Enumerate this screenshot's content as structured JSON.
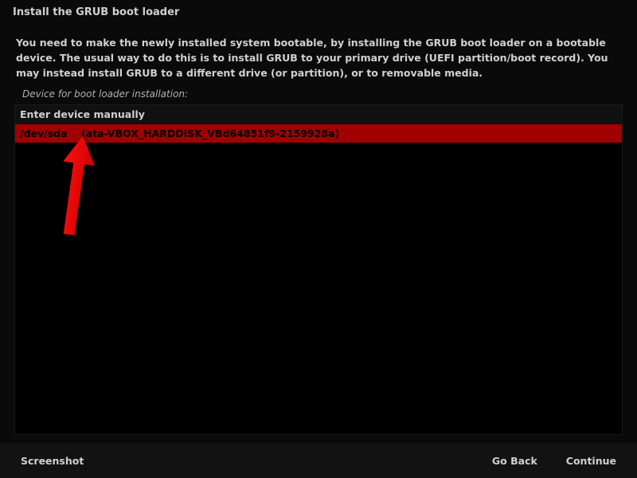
{
  "header": {
    "title": "Install the GRUB boot loader"
  },
  "description": "You need to make the newly installed system bootable, by installing the GRUB boot loader on a bootable device. The usual way to do this is to install GRUB to your primary drive (UEFI partition/boot record). You may instead install GRUB to a different drive (or partition), or to removable media.",
  "section_label": "Device for boot loader installation:",
  "devices": {
    "manual_label": "Enter device manually",
    "selected": {
      "path": "/dev/sda",
      "info": "(ata-VBOX_HARDDISK_VBd64851f9-2159928a)"
    }
  },
  "footer": {
    "screenshot": "Screenshot",
    "go_back": "Go Back",
    "continue": "Continue"
  }
}
